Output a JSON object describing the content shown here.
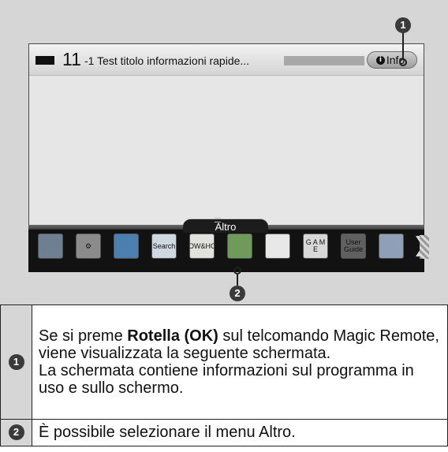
{
  "infobar": {
    "channel_number": "11",
    "channel_title": "-1 Test titolo informazioni rapide...",
    "info_button_label": "Info.",
    "info_icon": "info-icon"
  },
  "dock": {
    "tab_label": "Altro",
    "items": [
      {
        "name": "tv-guide-icon",
        "label": "",
        "color": "#6f7f92"
      },
      {
        "name": "settings-icon",
        "label": "⚙",
        "color": "#8b8b8b"
      },
      {
        "name": "internet-icon",
        "label": "",
        "color": "#4a7fb0"
      },
      {
        "name": "search-icon",
        "label": "Search",
        "color": "#cfd8e0"
      },
      {
        "name": "now-and-hot-icon",
        "label": "NOW&HOT",
        "color": "#e2e2dc"
      },
      {
        "name": "smartshare-icon",
        "label": "",
        "color": "#6f9b5a"
      },
      {
        "name": "clock-icon",
        "label": "",
        "color": "#e8e8e8"
      },
      {
        "name": "game-icon",
        "label": "G A M E",
        "color": "#d8d8d8"
      },
      {
        "name": "user-guide-icon",
        "label": "User Guide",
        "color": "#606060"
      },
      {
        "name": "photo-app-icon",
        "label": "",
        "color": "#8ea0b8"
      }
    ]
  },
  "callouts": {
    "top": "1",
    "bottom": "2"
  },
  "legend": {
    "rows": [
      {
        "num": "1",
        "text_before": "Se si preme ",
        "text_bold": "Rotella (OK)",
        "text_mid": " sul telcomando Magic Remote, viene visualizzata la seguente schermata.",
        "text_after": "La schermata contiene informazioni sul programma in uso e sullo schermo."
      },
      {
        "num": "2",
        "text": "È possibile selezionare il menu Altro."
      }
    ]
  }
}
